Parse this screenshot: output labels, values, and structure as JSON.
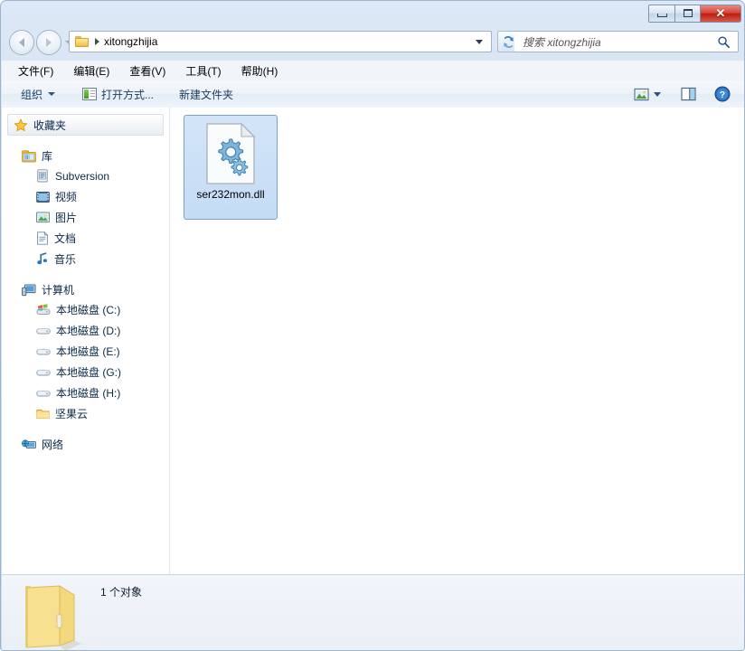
{
  "window": {
    "controls": {
      "minimize_label": "Minimize",
      "maximize_label": "Maximize",
      "close_label": "✕"
    }
  },
  "address": {
    "crumb": "xitongzhijia",
    "folder_icon": "folder-icon",
    "separator_icon": "chevron-right-icon",
    "dropdown_icon": "chevron-down-icon",
    "refresh_icon": "refresh-icon",
    "back_icon": "back-arrow-icon",
    "forward_icon": "forward-arrow-icon",
    "history_icon": "history-dropdown-icon"
  },
  "search": {
    "placeholder": "搜索 xitongzhijia",
    "icon": "search-icon"
  },
  "menu": {
    "items": [
      {
        "label": "文件(F)"
      },
      {
        "label": "编辑(E)"
      },
      {
        "label": "查看(V)"
      },
      {
        "label": "工具(T)"
      },
      {
        "label": "帮助(H)"
      }
    ]
  },
  "toolbar": {
    "organize_label": "组织",
    "open_with_label": "打开方式...",
    "new_folder_label": "新建文件夹",
    "view_icon": "view-options-icon",
    "view_caret_icon": "chevron-down-icon",
    "preview_pane_icon": "preview-pane-icon",
    "help_icon": "help-icon"
  },
  "sidebar": {
    "favorites": {
      "label": "收藏夹",
      "icon": "star-icon"
    },
    "library": {
      "label": "库",
      "icon": "library-icon",
      "items": [
        {
          "label": "Subversion",
          "icon": "subversion-icon"
        },
        {
          "label": "视频",
          "icon": "video-icon"
        },
        {
          "label": "图片",
          "icon": "pictures-icon"
        },
        {
          "label": "文档",
          "icon": "documents-icon"
        },
        {
          "label": "音乐",
          "icon": "music-icon"
        }
      ]
    },
    "computer": {
      "label": "计算机",
      "icon": "computer-icon",
      "items": [
        {
          "label": "本地磁盘 (C:)",
          "icon": "system-drive-icon"
        },
        {
          "label": "本地磁盘 (D:)",
          "icon": "drive-icon"
        },
        {
          "label": "本地磁盘 (E:)",
          "icon": "drive-icon"
        },
        {
          "label": "本地磁盘 (G:)",
          "icon": "drive-icon"
        },
        {
          "label": "本地磁盘 (H:)",
          "icon": "drive-icon"
        },
        {
          "label": "坚果云",
          "icon": "folder-icon"
        }
      ]
    },
    "network": {
      "label": "网络",
      "icon": "network-icon"
    }
  },
  "content": {
    "files": [
      {
        "name": "ser232mon.dll",
        "icon": "dll-gear-icon",
        "selected": true
      }
    ]
  },
  "status": {
    "text": "1 个对象",
    "icon": "folder-large-icon"
  },
  "colors": {
    "frame": "#d3e0f0",
    "close_button": "#bd1e12",
    "selection": "#c3dcf5",
    "selection_border": "#7da2ce",
    "sidebar_text": "#0b2a47"
  }
}
